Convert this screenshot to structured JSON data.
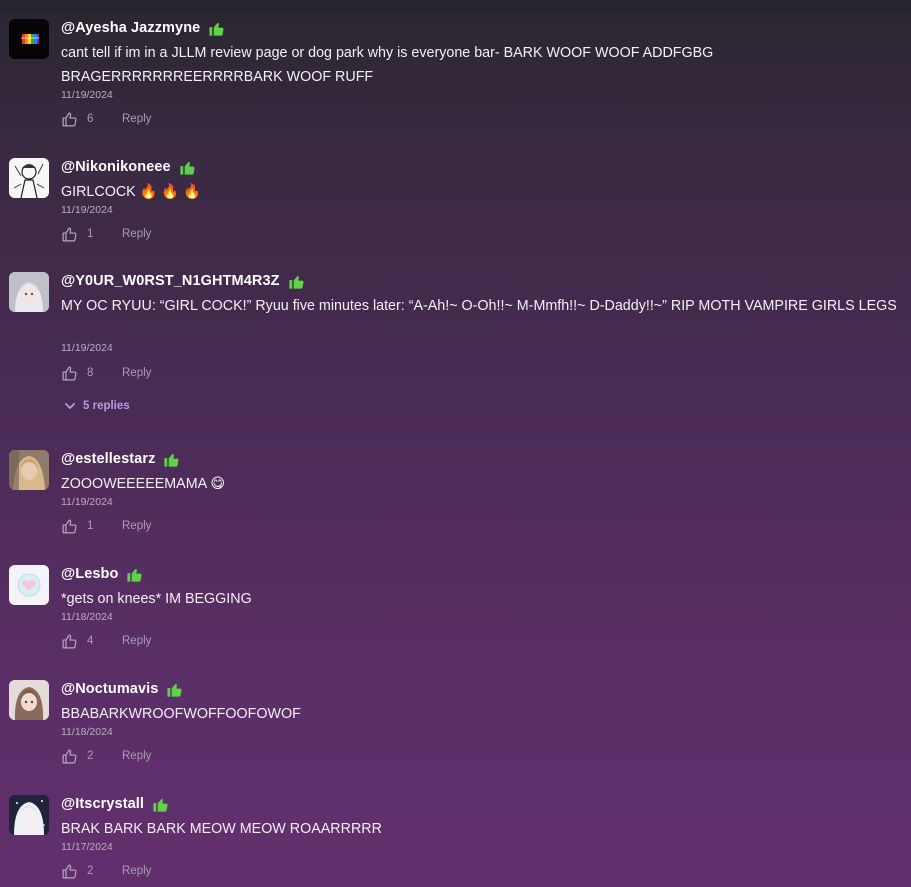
{
  "comments": [
    {
      "username": "@Ayesha Jazzmyne",
      "text": "cant tell if im in a JLLM review page or dog park why is everyone bar- BARK WOOF WOOF ADDFGBG BRAGERRRRRRREERRRRBARK WOOF RUFF",
      "date": "11/19/2024",
      "likes": "6",
      "reply_label": "Reply",
      "avatar": "rainbow-bar-avatar"
    },
    {
      "username": "@Nikonikoneee",
      "text": "GIRLCOCK 🔥 🔥 🔥",
      "date": "11/19/2024",
      "likes": "1",
      "reply_label": "Reply",
      "avatar": "manga-sketch-avatar"
    },
    {
      "username": "@Y0UR_W0RST_N1GHTM4R3Z",
      "text": "MY OC RYUU: “GIRL COCK!” Ryuu five minutes later: “A-Ah!~ O-Oh!!~ M-Mmfh!!~ D-Daddy!!~” RIP MOTH VAMPIRE GIRLS LEGS",
      "date": "11/19/2024",
      "likes": "8",
      "reply_label": "Reply",
      "avatar": "anime-grey-avatar",
      "replies_label": "5 replies"
    },
    {
      "username": "@estellestarz",
      "text": "ZOOOWEEEEEMAMA 😋",
      "date": "11/19/2024",
      "likes": "1",
      "reply_label": "Reply",
      "avatar": "photo-blonde-avatar"
    },
    {
      "username": "@Lesbo",
      "text": "*gets on knees* IM BEGGING",
      "date": "11/18/2024",
      "likes": "4",
      "reply_label": "Reply",
      "avatar": "pastel-heart-avatar"
    },
    {
      "username": "@Noctumavis",
      "text": "BBABARKWROOFWOFFOOFOWOF",
      "date": "11/18/2024",
      "likes": "2",
      "reply_label": "Reply",
      "avatar": "anime-brown-avatar"
    },
    {
      "username": "@Itscrystall",
      "text": "BRAK BARK BARK MEOW MEOW ROAARRRRR",
      "date": "11/17/2024",
      "likes": "2",
      "reply_label": "Reply",
      "avatar": "anime-white-avatar"
    }
  ],
  "colors": {
    "badge_green": "#5fd14a",
    "replies_purple": "#b99ae0",
    "muted": "#a99db4"
  }
}
